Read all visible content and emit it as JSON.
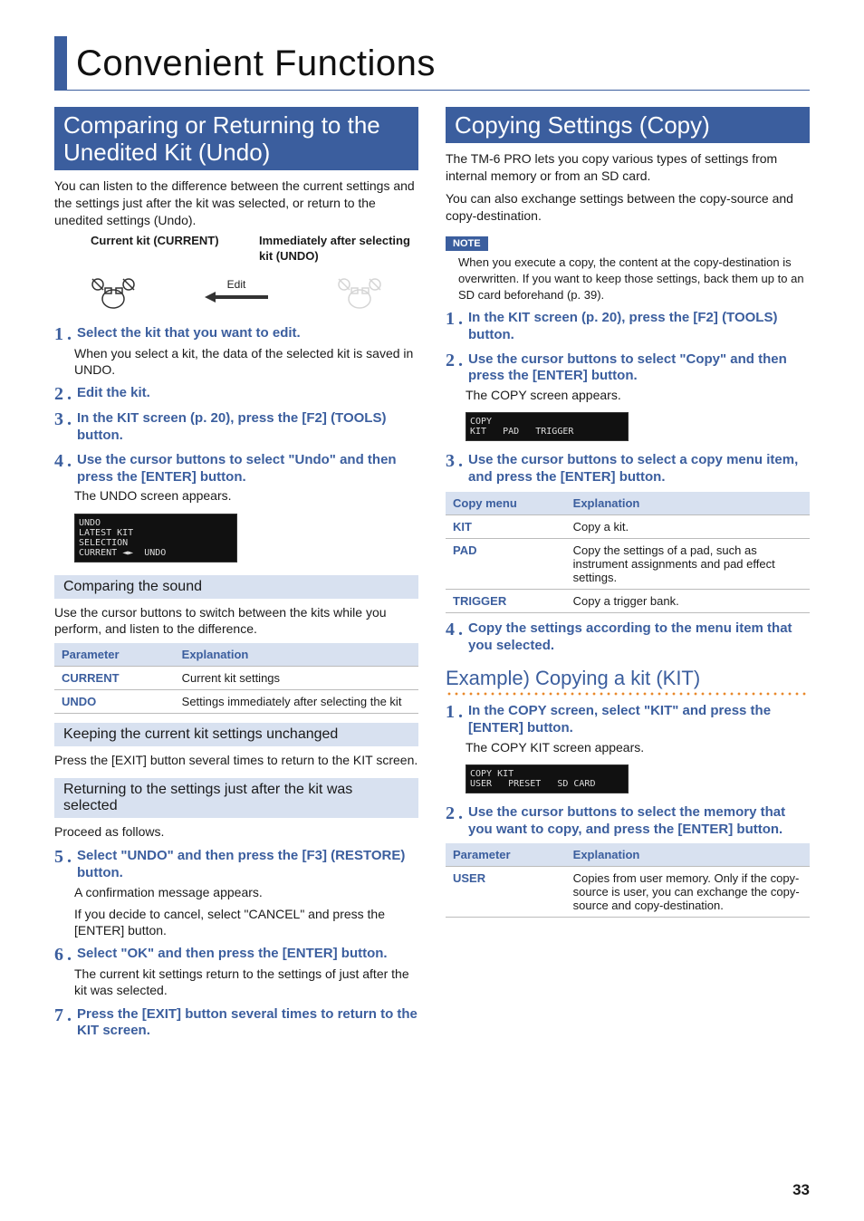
{
  "page_title": "Convenient Functions",
  "left": {
    "heading": "Comparing or Returning to the Unedited Kit (Undo)",
    "intro": "You can listen to the difference between the current settings and the settings just after the kit was selected, or return to the unedited settings (Undo).",
    "diag_hdr_left": "Current kit (CURRENT)",
    "diag_hdr_right": "Immediately after selecting kit (UNDO)",
    "diag_arrow_label": "Edit",
    "steps": [
      {
        "n": "1",
        "title": "Select the kit that you want to edit.",
        "body": "When you select a kit, the data of the selected kit is saved in UNDO."
      },
      {
        "n": "2",
        "title": "Edit the kit.",
        "body": ""
      },
      {
        "n": "3",
        "title": "In the KIT screen (p. 20), press the [F2] (TOOLS) button.",
        "body": ""
      },
      {
        "n": "4",
        "title": "Use the cursor buttons to select \"Undo\" and then press the [ENTER] button.",
        "body": "The UNDO screen appears."
      }
    ],
    "screenshot1_text": "UNDO\nLATEST KIT\nSELECTION\nCURRENT ◄►  UNDO",
    "sub1": "Comparing the sound",
    "sub1_body": "Use the cursor buttons to switch between the kits while you perform, and listen to the difference.",
    "table1": {
      "h0": "Parameter",
      "h1": "Explanation",
      "rows": [
        {
          "p": "CURRENT",
          "e": "Current kit settings"
        },
        {
          "p": "UNDO",
          "e": "Settings immediately after selecting the kit"
        }
      ]
    },
    "sub2": "Keeping the current kit settings unchanged",
    "sub2_body": "Press the [EXIT] button several times to return to the KIT screen.",
    "sub3": "Returning to the settings just after the kit was selected",
    "sub3_body": "Proceed as follows.",
    "steps_b": [
      {
        "n": "5",
        "title": "Select \"UNDO\" and then press the [F3] (RESTORE) button.",
        "body1": "A confirmation message appears.",
        "body2": "If you decide to cancel, select \"CANCEL\" and press the [ENTER] button."
      },
      {
        "n": "6",
        "title": "Select \"OK\" and then press the [ENTER] button.",
        "body1": "The current kit settings return to the settings of just after the kit was selected.",
        "body2": ""
      },
      {
        "n": "7",
        "title": "Press the [EXIT] button several times to return to the KIT screen.",
        "body1": "",
        "body2": ""
      }
    ]
  },
  "right": {
    "heading": "Copying Settings (Copy)",
    "intro1": "The TM-6 PRO lets you copy various types of settings from internal memory or from an SD card.",
    "intro2": "You can also exchange settings between the copy-source and copy-destination.",
    "note_label": "NOTE",
    "note_body": "When you execute a copy, the content at the copy-destination is overwritten. If you want to keep those settings, back them up to an SD card beforehand (p. 39).",
    "steps1": [
      {
        "n": "1",
        "title": "In the KIT screen (p. 20), press the [F2] (TOOLS) button.",
        "body": ""
      },
      {
        "n": "2",
        "title": "Use the cursor buttons to select \"Copy\" and then press the [ENTER] button.",
        "body": "The COPY screen appears."
      }
    ],
    "screenshot1_text": "COPY\nKIT   PAD   TRIGGER",
    "steps2": [
      {
        "n": "3",
        "title": "Use the cursor buttons to select a copy menu item, and press the [ENTER] button.",
        "body": ""
      }
    ],
    "table1": {
      "h0": "Copy menu",
      "h1": "Explanation",
      "rows": [
        {
          "p": "KIT",
          "e": "Copy a kit."
        },
        {
          "p": "PAD",
          "e": "Copy the settings of a pad, such as instrument assignments and pad effect settings."
        },
        {
          "p": "TRIGGER",
          "e": "Copy a trigger bank."
        }
      ]
    },
    "steps3": [
      {
        "n": "4",
        "title": "Copy the settings according to the menu item that you selected.",
        "body": ""
      }
    ],
    "example_heading": "Example) Copying a kit (KIT)",
    "ex_steps1": [
      {
        "n": "1",
        "title": "In the COPY screen, select \"KIT\" and press the [ENTER] button.",
        "body": "The COPY KIT screen appears."
      }
    ],
    "screenshot2_text": "COPY KIT\nUSER   PRESET   SD CARD",
    "ex_steps2": [
      {
        "n": "2",
        "title": "Use the cursor buttons to select the memory that you want to copy, and press the [ENTER] button.",
        "body": ""
      }
    ],
    "table2": {
      "h0": "Parameter",
      "h1": "Explanation",
      "rows": [
        {
          "p": "USER",
          "e": "Copies from user memory. Only if the copy-source is user, you can exchange the copy-source and copy-destination."
        }
      ]
    }
  },
  "page_number": "33"
}
